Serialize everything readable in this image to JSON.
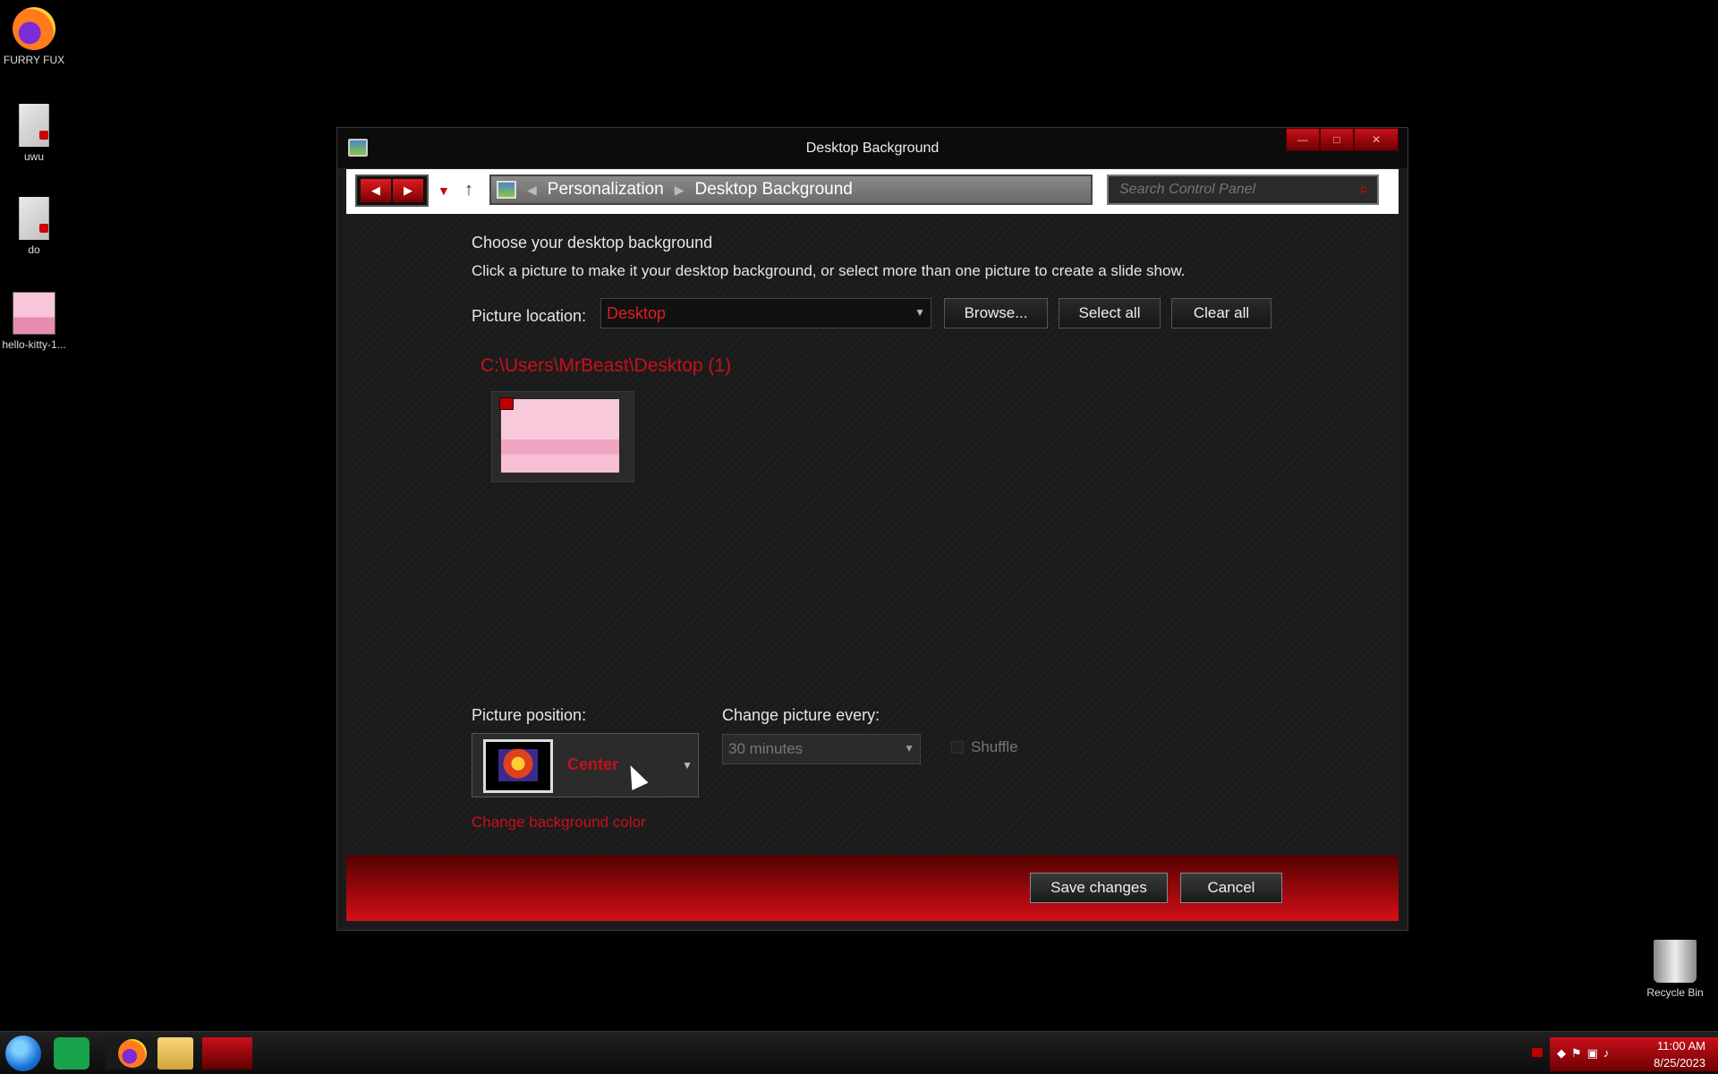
{
  "desktop": {
    "icons": [
      {
        "label": "FURRY FUX",
        "icon": "firefox-icon"
      },
      {
        "label": "uwu",
        "icon": "file-icon"
      },
      {
        "label": "do",
        "icon": "file-icon"
      },
      {
        "label": "hello-kitty-1...",
        "icon": "image-icon"
      },
      {
        "label": "Recycle Bin",
        "icon": "recycle-bin-icon"
      }
    ]
  },
  "window": {
    "title": "Desktop Background",
    "controls": {
      "minimize": "—",
      "maximize": "□",
      "close": "✕"
    }
  },
  "navbar": {
    "back": "◀",
    "forward": "▶",
    "breadcrumb": [
      "Personalization",
      "Desktop Background"
    ],
    "search_placeholder": "Search Control Panel"
  },
  "content": {
    "heading": "Choose your desktop background",
    "description": "Click a picture to make it your desktop background, or select more than one picture to create a slide show.",
    "picture_location_label": "Picture location:",
    "picture_location_value": "Desktop",
    "browse_label": "Browse...",
    "select_all_label": "Select all",
    "clear_all_label": "Clear all",
    "folder_label": "C:\\Users\\MrBeast\\Desktop (1)",
    "picture_position_label": "Picture position:",
    "picture_position_value": "Center",
    "change_every_label": "Change picture every:",
    "change_every_value": "30 minutes",
    "shuffle_label": "Shuffle",
    "change_bg_color_label": "Change background color"
  },
  "footer": {
    "save_label": "Save changes",
    "cancel_label": "Cancel"
  },
  "taskbar": {
    "time": "11:00 AM",
    "date": "8/25/2023"
  },
  "colors": {
    "accent": "#c8101b",
    "window_bg": "#1b1b1b",
    "desktop_bg": "#000000"
  }
}
